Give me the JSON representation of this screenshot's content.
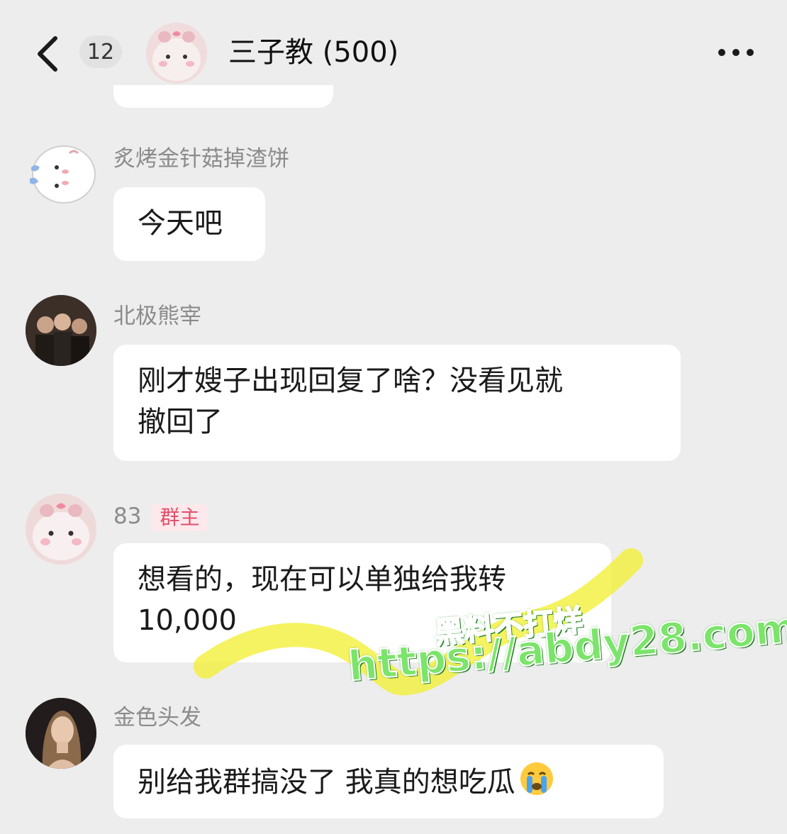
{
  "header": {
    "back_icon": "chevron-left-icon",
    "unread_count": "12",
    "group_title": "三子教 (500)",
    "more_icon": "more-dots-icon"
  },
  "messages": [
    {
      "sender": "炙烤金针菇掉渣饼",
      "text": "今天吧"
    },
    {
      "sender": "北极熊宰",
      "text_line1": "刚才嫂子出现回复了啥？没看见就",
      "text_line2": "撤回了"
    },
    {
      "sender": "83",
      "role": "群主",
      "text_line1": "想看的，现在可以单独给我转",
      "text_line2": "10,000"
    },
    {
      "sender": "金色头发",
      "text": "别给我群搞没了 我真的想吃瓜",
      "emoji": "crying-face-icon"
    }
  ],
  "watermark": {
    "line1": "黑料不打烊",
    "line2": "https://abdy28.com"
  },
  "colors": {
    "background": "#ededed",
    "bubble": "#ffffff",
    "sender_name": "#8b8b8b",
    "role_badge_text": "#e0506a",
    "role_badge_bg": "#fde8ec",
    "highlight": "#f2f034",
    "watermark": "#7be46a"
  }
}
